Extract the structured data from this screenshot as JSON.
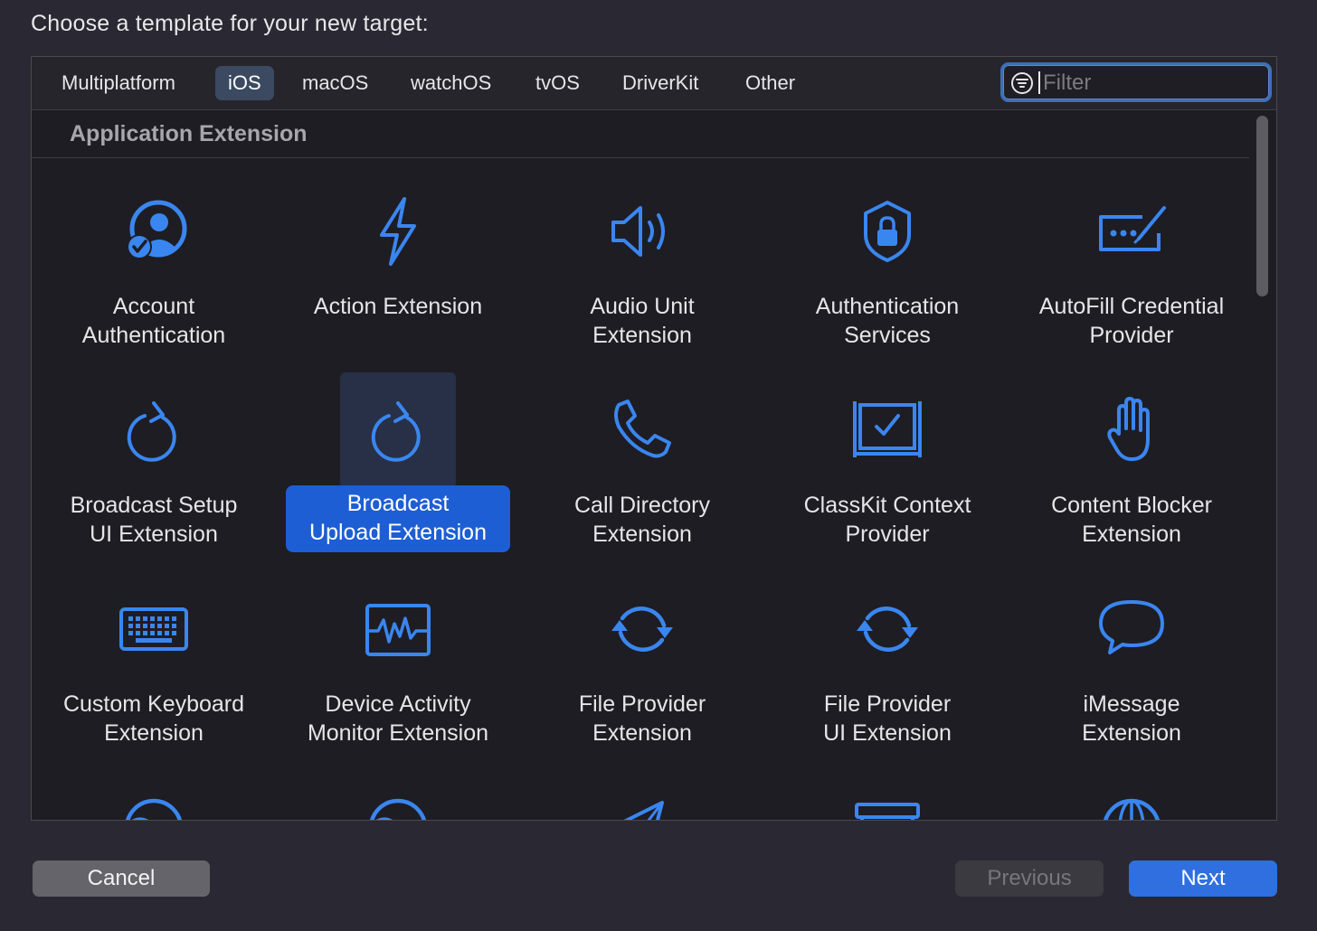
{
  "dialog": {
    "prompt": "Choose a template for your new target:",
    "filter_placeholder": "Filter",
    "filter_value": ""
  },
  "tabs": [
    {
      "label": "Multiplatform",
      "active": false
    },
    {
      "label": "iOS",
      "active": true
    },
    {
      "label": "macOS",
      "active": false
    },
    {
      "label": "watchOS",
      "active": false
    },
    {
      "label": "tvOS",
      "active": false
    },
    {
      "label": "DriverKit",
      "active": false
    },
    {
      "label": "Other",
      "active": false
    }
  ],
  "section": {
    "title": "Application Extension"
  },
  "templates": [
    {
      "icon": "account-authentication-icon",
      "lines": [
        "Account",
        "Authentication"
      ],
      "selected": false
    },
    {
      "icon": "lightning-bolt-icon",
      "lines": [
        "Action Extension"
      ],
      "selected": false
    },
    {
      "icon": "speaker-icon",
      "lines": [
        "Audio Unit",
        "Extension"
      ],
      "selected": false
    },
    {
      "icon": "shield-lock-icon",
      "lines": [
        "Authentication",
        "Services"
      ],
      "selected": false
    },
    {
      "icon": "password-field-pen-icon",
      "lines": [
        "AutoFill Credential",
        "Provider"
      ],
      "selected": false
    },
    {
      "icon": "clockwise-arrow-icon",
      "lines": [
        "Broadcast Setup",
        "UI Extension"
      ],
      "selected": false
    },
    {
      "icon": "clockwise-arrow-icon",
      "lines": [
        "Broadcast",
        "Upload Extension"
      ],
      "selected": true
    },
    {
      "icon": "phone-icon",
      "lines": [
        "Call Directory",
        "Extension"
      ],
      "selected": false
    },
    {
      "icon": "checkmark-board-icon",
      "lines": [
        "ClassKit Context",
        "Provider"
      ],
      "selected": false
    },
    {
      "icon": "hand-raised-icon",
      "lines": [
        "Content Blocker",
        "Extension"
      ],
      "selected": false
    },
    {
      "icon": "keyboard-icon",
      "lines": [
        "Custom Keyboard",
        "Extension"
      ],
      "selected": false
    },
    {
      "icon": "waveform-monitor-icon",
      "lines": [
        "Device Activity",
        "Monitor Extension"
      ],
      "selected": false
    },
    {
      "icon": "sync-arrows-icon",
      "lines": [
        "File Provider",
        "Extension"
      ],
      "selected": false
    },
    {
      "icon": "sync-arrows-icon",
      "lines": [
        "File Provider",
        "UI Extension"
      ],
      "selected": false
    },
    {
      "icon": "speech-bubble-icon",
      "lines": [
        "iMessage",
        "Extension"
      ],
      "selected": false
    },
    {
      "icon": "gauge-icon",
      "lines": [],
      "selected": false
    },
    {
      "icon": "gauge-icon",
      "lines": [],
      "selected": false
    },
    {
      "icon": "paper-plane-icon",
      "lines": [],
      "selected": false
    },
    {
      "icon": "tray-box-icon",
      "lines": [],
      "selected": false
    },
    {
      "icon": "globe-icon",
      "lines": [],
      "selected": false
    }
  ],
  "buttons": {
    "cancel": "Cancel",
    "previous": "Previous",
    "next": "Next"
  },
  "colors": {
    "accent": "#2f6fe0",
    "icon_blue": "#3a86f0",
    "selection": "#1d5ed4",
    "background": "#2a2832"
  }
}
